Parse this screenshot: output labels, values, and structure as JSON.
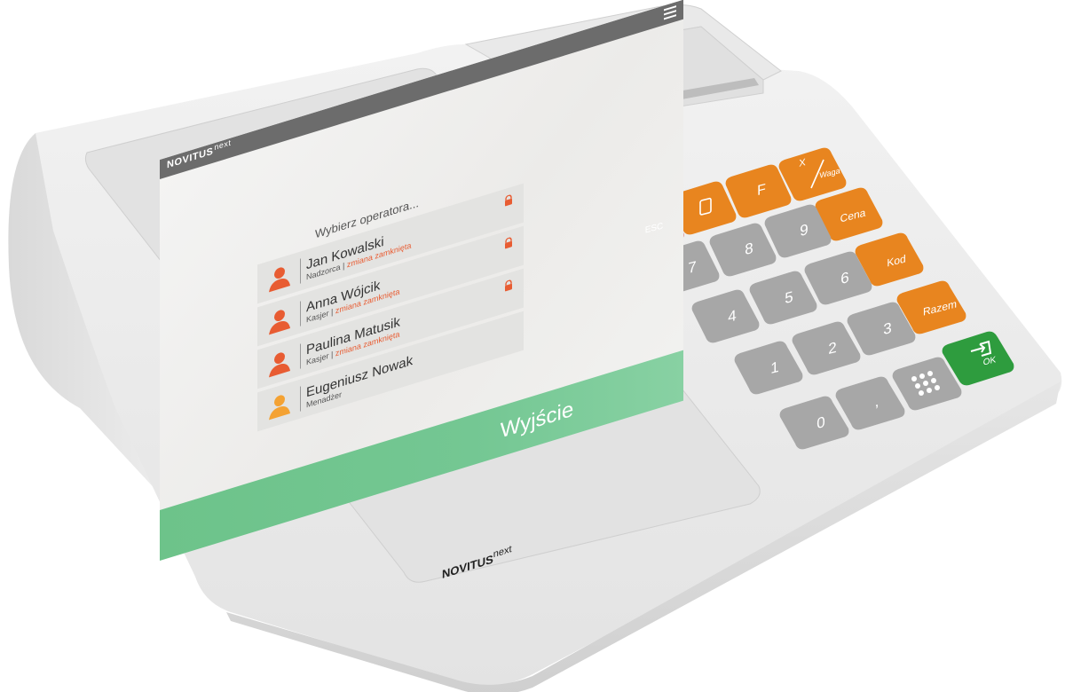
{
  "screen": {
    "brand_main": "NOVITUS",
    "brand_sup": "next",
    "prompt": "Wybierz operatora...",
    "operators": [
      {
        "name": "Jan Kowalski",
        "role": "Nadzorca",
        "state": "zmiana zamknięta",
        "avatar_color": "#e85c32",
        "locked": true
      },
      {
        "name": "Anna Wójcik",
        "role": "Kasjer",
        "state": "zmiana zamknięta",
        "avatar_color": "#e85c32",
        "locked": true
      },
      {
        "name": "Paulina Matusik",
        "role": "Kasjer",
        "state": "zmiana zamknięta",
        "avatar_color": "#e85c32",
        "locked": true
      },
      {
        "name": "Eugeniusz Nowak",
        "role": "Menadżer",
        "state": "",
        "avatar_color": "#f4a233",
        "locked": false
      }
    ],
    "exit_label": "Wyjście"
  },
  "keypad": {
    "esc": "ESC",
    "f": "F",
    "x": "X",
    "waga": "Waga",
    "cena": "Cena",
    "kod": "Kod",
    "razem": "Razem",
    "ok": "OK",
    "digits": [
      "7",
      "8",
      "9",
      "4",
      "5",
      "6",
      "1",
      "2",
      "3",
      "0",
      ","
    ],
    "colors": {
      "orange": "#e8851f",
      "red": "#c8282b",
      "green": "#2e9c3e",
      "gray": "#a7a7a7"
    }
  },
  "device": {
    "brand_main": "NOVITUS",
    "brand_sup": "next"
  }
}
